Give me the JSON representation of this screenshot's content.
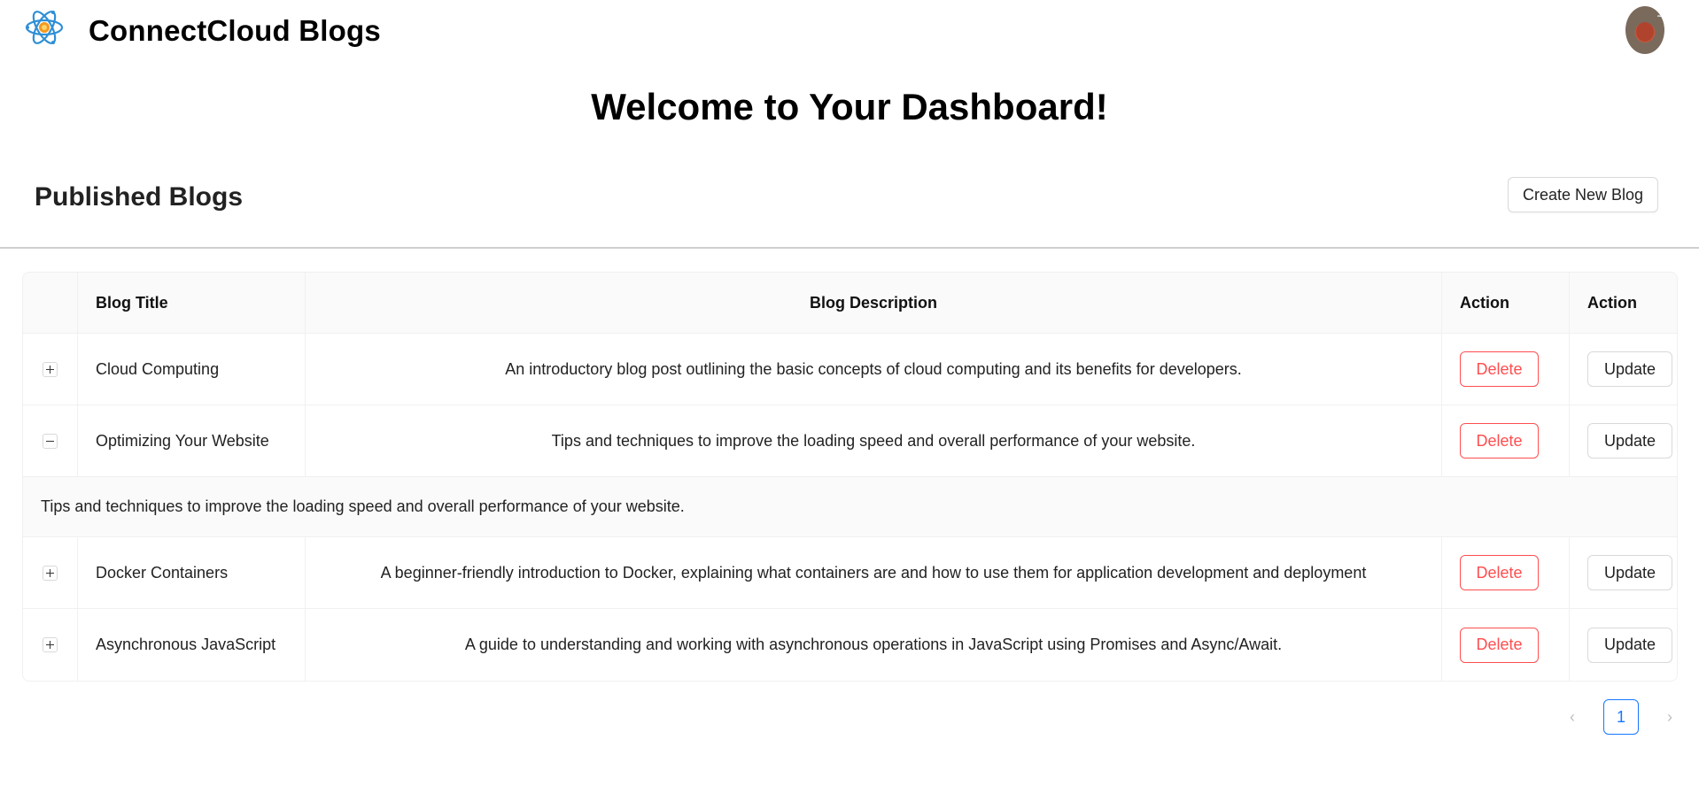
{
  "header": {
    "brand": "ConnectCloud Blogs",
    "logo_icon": "atom-icon",
    "avatar_icon": "user-avatar"
  },
  "welcome": "Welcome to Your Dashboard!",
  "section": {
    "title": "Published Blogs",
    "create_label": "Create New Blog"
  },
  "table": {
    "headers": {
      "title": "Blog Title",
      "description": "Blog Description",
      "action1": "Action",
      "action2": "Action"
    },
    "rows": [
      {
        "title": "Cloud Computing",
        "description": "An introductory blog post outlining the basic concepts of cloud computing and its benefits for developers.",
        "delete_label": "Delete",
        "update_label": "Update"
      },
      {
        "title": "Optimizing Your Website",
        "description": "Tips and techniques to improve the loading speed and overall performance of your website.",
        "delete_label": "Delete",
        "update_label": "Update",
        "expanded_text": "Tips and techniques to improve the loading speed and overall performance of your website."
      },
      {
        "title": "Docker Containers",
        "description": "A beginner-friendly introduction to Docker, explaining what containers are and how to use them for application development and deployment",
        "delete_label": "Delete",
        "update_label": "Update"
      },
      {
        "title": "Asynchronous JavaScript",
        "description": "A guide to understanding and working with asynchronous operations in JavaScript using Promises and Async/Await.",
        "delete_label": "Delete",
        "update_label": "Update"
      }
    ]
  },
  "pagination": {
    "current_page": "1",
    "prev_icon": "chevron-left-icon",
    "next_icon": "chevron-right-icon"
  },
  "colors": {
    "danger": "#ff4d4f",
    "primary": "#1677ff",
    "header_bg": "#fafafa"
  }
}
